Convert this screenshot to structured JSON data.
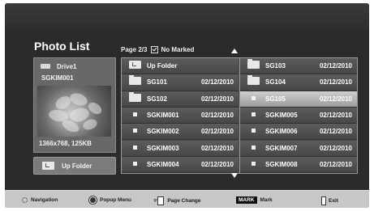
{
  "title": "Photo List",
  "page_info": {
    "page": "Page 2/3",
    "marked": "No Marked"
  },
  "drive": {
    "name": "Drive1",
    "current_file": "SGKIM001",
    "meta": "1366x768, 125KB"
  },
  "up_folder_button": "Up Folder",
  "grid": {
    "left": [
      {
        "type": "upfolder",
        "name": "Up Folder",
        "date": ""
      },
      {
        "type": "folder",
        "name": "SG101",
        "date": "02/12/2010"
      },
      {
        "type": "folder",
        "name": "SG102",
        "date": "02/12/2010"
      },
      {
        "type": "file",
        "name": "SGKIM001",
        "date": "02/12/2010"
      },
      {
        "type": "file",
        "name": "SGKIM002",
        "date": "02/12/2010"
      },
      {
        "type": "file",
        "name": "SGKIM003",
        "date": "02/12/2010"
      },
      {
        "type": "file",
        "name": "SGKIM004",
        "date": "02/12/2010"
      }
    ],
    "right": [
      {
        "type": "folder",
        "name": "SG103",
        "date": "02/12/2010"
      },
      {
        "type": "folder",
        "name": "SG104",
        "date": "02/12/2010"
      },
      {
        "type": "file",
        "name": "SG105",
        "date": "02/12/2010",
        "selected": true
      },
      {
        "type": "file",
        "name": "SGKIM005",
        "date": "02/12/2010"
      },
      {
        "type": "file",
        "name": "SGKIM006",
        "date": "02/12/2010"
      },
      {
        "type": "file",
        "name": "SGKIM007",
        "date": "02/12/2010"
      },
      {
        "type": "file",
        "name": "SGKIM008",
        "date": "02/12/2010"
      }
    ]
  },
  "bottom_bar": {
    "navigation": "Navigation",
    "popup_menu": "Popup Menu",
    "page_change_prefix": "P",
    "page_change": "Page Change",
    "mark_key": "MARK",
    "mark": "Mark",
    "exit": "Exit"
  }
}
